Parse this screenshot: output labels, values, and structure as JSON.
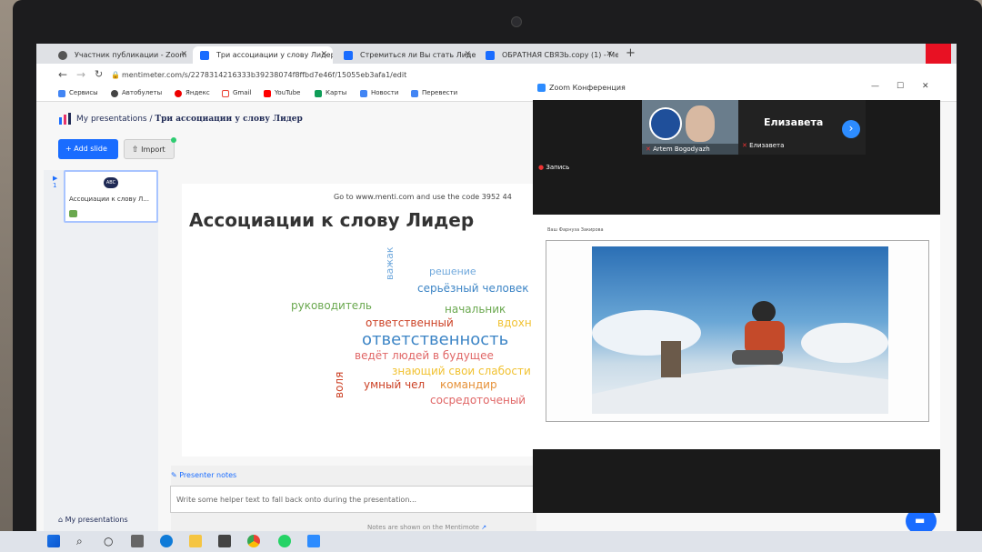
{
  "browser": {
    "tabs": [
      {
        "label": "Участник публикации - Zoom"
      },
      {
        "label": "Три ассоциации у слову Лидер"
      },
      {
        "label": "Стремиться ли Вы стать Лидер"
      },
      {
        "label": "ОБРАТНАЯ СВЯЗЬ.copy (1) - Ме"
      }
    ],
    "url": "mentimeter.com/s/2278314216333b39238074f8ffbd7e46f/15055eb3afa1/edit",
    "bookmarks": [
      "Сервисы",
      "Автобулеты",
      "Яндекс",
      "Gmail",
      "YouTube",
      "Карты",
      "Новости",
      "Перевести"
    ]
  },
  "app": {
    "breadcrumb_root": "My presentations",
    "breadcrumb_separator": "/",
    "breadcrumb_title": "Три ассоциации у слову Лидер",
    "add_slide_label": "+ Add slide",
    "import_label": "Import",
    "slide_thumb_badge": "ABC",
    "slide_thumb_title": "Ассоциации к слову Л...",
    "slide_number": "1",
    "join_text": "Go to www.menti.com and use the code 3952 44",
    "slide_title": "Ассоциации к слову Лидер",
    "word_cloud": [
      {
        "text": "решение",
        "color": "#6fa8dc"
      },
      {
        "text": "важак",
        "color": "#6fa8dc"
      },
      {
        "text": "серьёзный человек",
        "color": "#3d85c6"
      },
      {
        "text": "руководитель",
        "color": "#6aa84f"
      },
      {
        "text": "начальник",
        "color": "#6aa84f"
      },
      {
        "text": "ответственный",
        "color": "#cc4125"
      },
      {
        "text": "вдохн",
        "color": "#f1c232"
      },
      {
        "text": "ответственность",
        "color": "#3d85c6"
      },
      {
        "text": "ведёт людей в будущее",
        "color": "#e06666"
      },
      {
        "text": "знающий свои слабости",
        "color": "#f1c232"
      },
      {
        "text": "воля",
        "color": "#cc4125"
      },
      {
        "text": "умный чел",
        "color": "#cc4125"
      },
      {
        "text": "командир",
        "color": "#e69138"
      },
      {
        "text": "сосредоточеный",
        "color": "#e06666"
      }
    ],
    "presenter_notes_label": "Presenter notes",
    "notes_placeholder": "Write some helper text to fall back onto during the presentation...",
    "my_presentations_footer": "My presentations",
    "notes_footer": "Notes are shown on the Mentimote"
  },
  "zoom": {
    "window_title": "Zoom Конференция",
    "participant_1": "Artem Bogodyazh",
    "participant_2_big": "Елизавета",
    "participant_2": "Елизавета",
    "recording_label": "Запись",
    "share_caption": "Ваш Фарнуза Закирова"
  },
  "colors": {
    "accent": "#196cff",
    "brand_dark": "#1f2a55"
  }
}
